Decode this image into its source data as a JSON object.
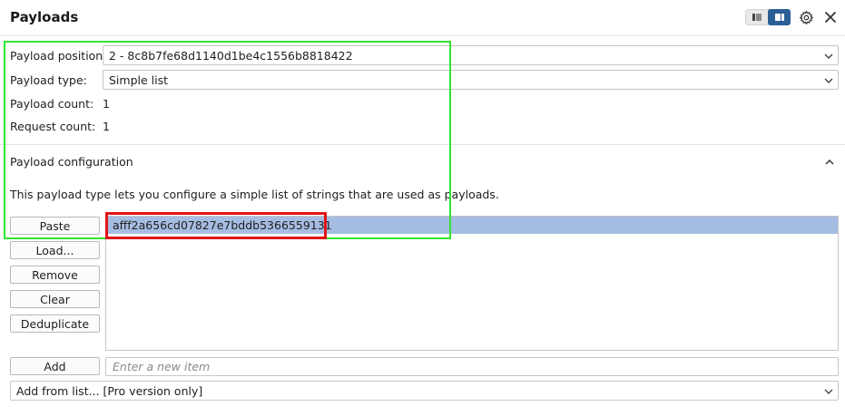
{
  "header": {
    "title": "Payloads",
    "layout_toggle_left_icon": "list-layout-icon",
    "layout_toggle_right_icon": "panel-layout-icon",
    "settings_icon": "gear-icon",
    "close_icon": "close-icon"
  },
  "payload_sets": {
    "position_label": "Payload position:",
    "position_value": "2 - 8c8b7fe68d1140d1be4c1556b8818422",
    "type_label": "Payload type:",
    "type_value": "Simple list",
    "count_label": "Payload count:",
    "count_value": "1",
    "request_label": "Request count:",
    "request_value": "1"
  },
  "payload_configuration": {
    "section_title": "Payload configuration",
    "description": "This payload type lets you configure a simple list of strings that are used as payloads.",
    "buttons": {
      "paste": "Paste",
      "load": "Load...",
      "remove": "Remove",
      "clear": "Clear",
      "deduplicate": "Deduplicate",
      "add": "Add"
    },
    "items": [
      "afff2a656cd07827e7bddb5366559131"
    ],
    "add_placeholder": "Enter a new item",
    "add_from_list": "Add from list... [Pro version only]"
  },
  "colors": {
    "accent": "#2b5f95",
    "selection": "#a6bde3",
    "highlight_green": "#31e631",
    "highlight_red": "#e01515"
  }
}
